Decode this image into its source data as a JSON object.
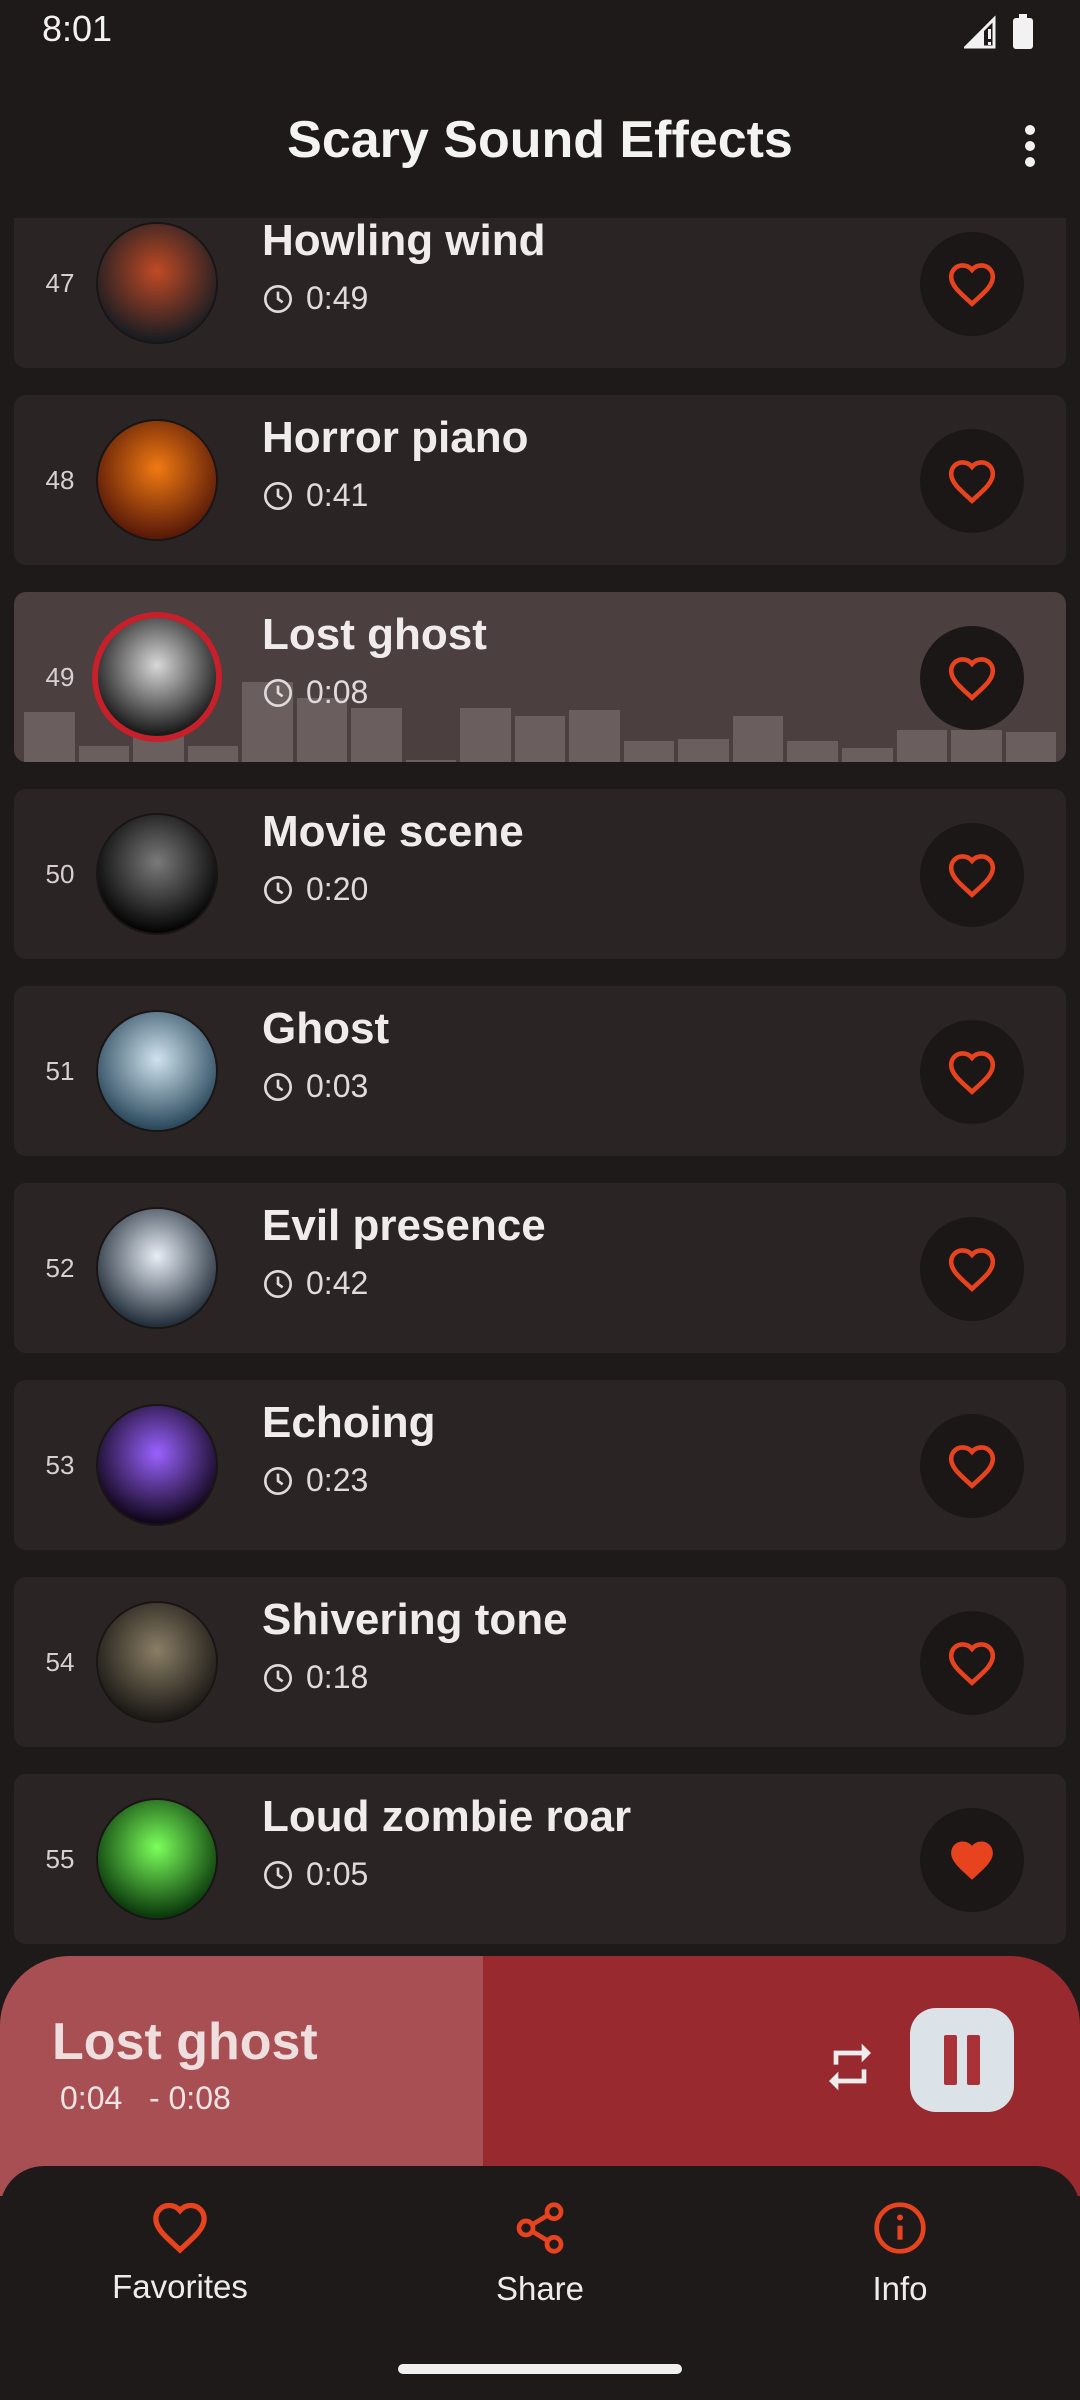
{
  "status": {
    "time": "8:01"
  },
  "app_bar": {
    "title": "Scary Sound Effects"
  },
  "colors": {
    "accent": "#e8431f",
    "active_ring": "#c8202a",
    "player_bg": "#982a2f"
  },
  "sounds": [
    {
      "num": "47",
      "title": "Howling wind",
      "duration": "0:49",
      "favorite": false,
      "art": [
        "#c04a26",
        "#1a1d22"
      ]
    },
    {
      "num": "48",
      "title": "Horror piano",
      "duration": "0:41",
      "favorite": false,
      "art": [
        "#f07a12",
        "#5a1a08"
      ]
    },
    {
      "num": "49",
      "title": "Lost ghost",
      "duration": "0:08",
      "favorite": false,
      "active": true,
      "art": [
        "#d8d8d8",
        "#1a1a1a"
      ]
    },
    {
      "num": "50",
      "title": "Movie scene",
      "duration": "0:20",
      "favorite": false,
      "art": [
        "#7a7a7a",
        "#050505"
      ]
    },
    {
      "num": "51",
      "title": "Ghost",
      "duration": "0:03",
      "favorite": false,
      "art": [
        "#cfe3ee",
        "#2c4a5e"
      ]
    },
    {
      "num": "52",
      "title": "Evil presence",
      "duration": "0:42",
      "favorite": false,
      "art": [
        "#e8eef6",
        "#24303c"
      ]
    },
    {
      "num": "53",
      "title": "Echoing",
      "duration": "0:23",
      "favorite": false,
      "art": [
        "#9a62ff",
        "#12071c"
      ]
    },
    {
      "num": "54",
      "title": "Shivering tone",
      "duration": "0:18",
      "favorite": false,
      "art": [
        "#8a7e66",
        "#1c1a16"
      ]
    },
    {
      "num": "55",
      "title": "Loud zombie roar",
      "duration": "0:05",
      "favorite": true,
      "art": [
        "#7cff5c",
        "#0b3a0c"
      ]
    }
  ],
  "equalizer_levels": [
    0.62,
    0.2,
    0.38,
    0.2,
    1.0,
    0.8,
    0.68,
    0.02,
    0.68,
    0.58,
    0.65,
    0.26,
    0.29,
    0.57,
    0.26,
    0.17,
    0.4,
    0.4,
    0.38
  ],
  "player": {
    "title": "Lost ghost",
    "elapsed": "0:04",
    "remaining": "- 0:08",
    "progress": 0.447
  },
  "nav": {
    "favorites": "Favorites",
    "share": "Share",
    "info": "Info"
  }
}
